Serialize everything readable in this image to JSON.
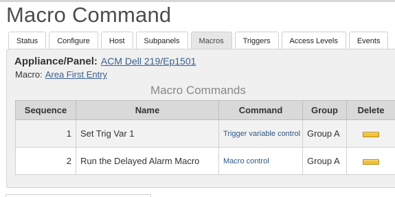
{
  "page": {
    "title": "Macro Command"
  },
  "tabs": [
    {
      "label": "Status",
      "active": false
    },
    {
      "label": "Configure",
      "active": false
    },
    {
      "label": "Host",
      "active": false
    },
    {
      "label": "Subpanels",
      "active": false
    },
    {
      "label": "Macros",
      "active": true
    },
    {
      "label": "Triggers",
      "active": false
    },
    {
      "label": "Access Levels",
      "active": false
    },
    {
      "label": "Events",
      "active": false
    }
  ],
  "appliance": {
    "label": "Appliance/Panel:",
    "value": "ACM Dell 219/Ep1501"
  },
  "macro": {
    "label": "Macro:",
    "value": "Area First Entry"
  },
  "section": {
    "heading": "Macro Commands"
  },
  "table": {
    "columns": [
      "Sequence",
      "Name",
      "Command",
      "Group",
      "Delete"
    ],
    "rows": [
      {
        "sequence": "1",
        "name": "Set Trig Var 1",
        "command": "Trigger variable control",
        "group": "Group A"
      },
      {
        "sequence": "2",
        "name": "Run the Delayed Alarm Macro",
        "command": "Macro control",
        "group": "Group A"
      }
    ]
  },
  "colors": {
    "delete_button": "#f2c23a",
    "link": "#3a5f8f",
    "header_bg": "#d9d9d9"
  },
  "icons": {
    "delete": "delete-button-icon"
  }
}
